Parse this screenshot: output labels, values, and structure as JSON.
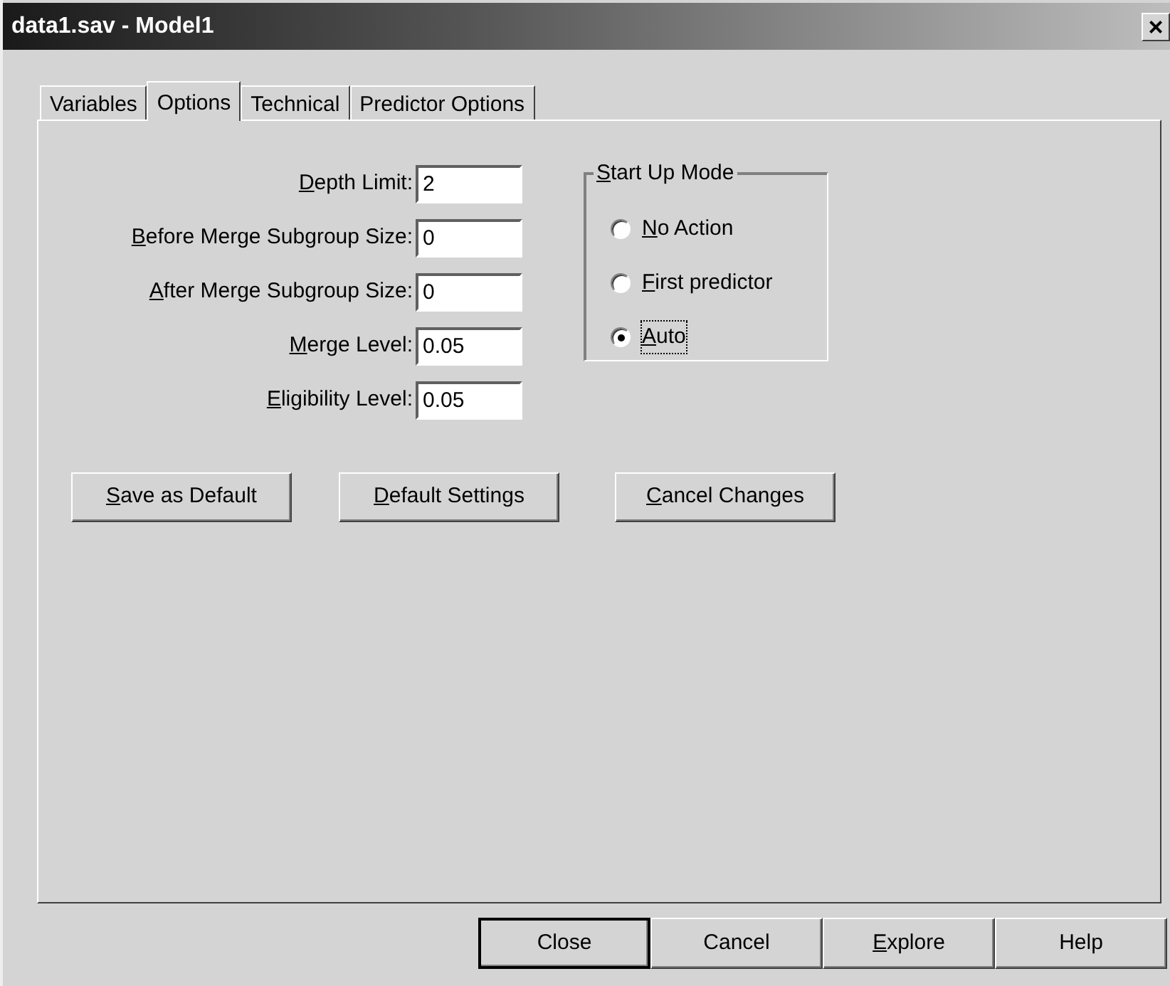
{
  "window": {
    "title": "data1.sav - Model1",
    "close": "×"
  },
  "tabs": [
    {
      "label": "Variables",
      "selected": false
    },
    {
      "label": "Options",
      "selected": true
    },
    {
      "label": "Technical",
      "selected": false
    },
    {
      "label": "Predictor Options",
      "selected": false
    }
  ],
  "fields": [
    {
      "label": "Depth Limit:",
      "underlined_first": true,
      "value": "2"
    },
    {
      "label": "Before Merge Subgroup Size:",
      "underlined_first": true,
      "value": "0"
    },
    {
      "label": "After Merge Subgroup Size:",
      "underlined_first": true,
      "value": "0"
    },
    {
      "label": "Merge Level:",
      "underlined_first": true,
      "value": "0.05"
    },
    {
      "label": "Eligibility Level:",
      "underlined_first": true,
      "value": "0.05"
    }
  ],
  "start_up_mode": {
    "title": "Start Up Mode",
    "underlined_first": true,
    "options": [
      {
        "label": "No Action",
        "underlined_first": true,
        "selected": false,
        "focused": false
      },
      {
        "label": "First predictor",
        "underlined_first": true,
        "selected": false,
        "focused": false
      },
      {
        "label": "Auto",
        "underlined_first": true,
        "selected": true,
        "focused": true
      }
    ]
  },
  "panel_buttons": [
    {
      "label": "Save as Default",
      "underlined_first": true
    },
    {
      "label": "Default Settings",
      "underlined_first": true
    },
    {
      "label": "Cancel Changes",
      "underlined_first": true
    }
  ],
  "dialog_buttons": [
    {
      "label": "Close",
      "underlined_first": false,
      "default": true
    },
    {
      "label": "Cancel",
      "underlined_first": false,
      "default": false
    },
    {
      "label": "Explore",
      "underlined_first": true,
      "default": false
    },
    {
      "label": "Help",
      "underlined_first": false,
      "default": false
    }
  ]
}
